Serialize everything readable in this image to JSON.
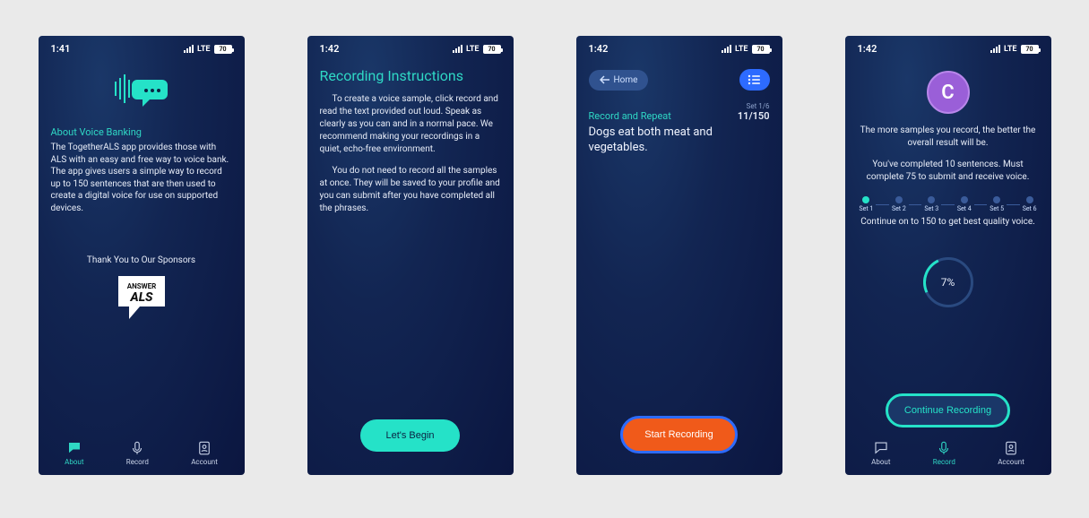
{
  "status": {
    "time1": "1:41",
    "time2": "1:42",
    "time3": "1:42",
    "time4": "1:42",
    "network": "LTE",
    "battery": "70"
  },
  "screen1": {
    "heading": "About Voice Banking",
    "body": "The TogetherALS app provides those with ALS with an easy and free way to voice bank. The app gives users a simple way to record up to 150 sentences that are then used to create a digital voice for use on supported devices.",
    "thanks": "Thank You to Our Sponsors",
    "sponsor_top": "ANSWER",
    "sponsor_bottom": "ALS"
  },
  "screen2": {
    "title": "Recording Instructions",
    "p1": "To create a voice sample, click record and read the text provided out loud. Speak as clearly as you can and in a normal pace. We recommend making your recordings in a quiet, echo-free environment.",
    "p2": "You do not need to record all the samples at once. They will be saved to your profile and you can submit after you have completed all the phrases.",
    "cta": "Let's Begin"
  },
  "screen3": {
    "home": "Home",
    "set_meta": "Set 1/6",
    "count": "11/150",
    "label": "Record and Repeat",
    "sentence": "Dogs eat both meat and vegetables.",
    "cta": "Start Recording"
  },
  "screen4": {
    "avatar": "C",
    "p1": "The more samples you record, the better the overall result will be.",
    "p2": "You've completed 10 sentences. Must complete 75 to submit and receive voice.",
    "p3": "Continue on to 150 to get best quality voice.",
    "sets": [
      "Set 1",
      "Set 2",
      "Set 3",
      "Set 4",
      "Set 5",
      "Set 6"
    ],
    "percent": "7%",
    "cta": "Continue Recording"
  },
  "nav": {
    "about": "About",
    "record": "Record",
    "account": "Account"
  }
}
